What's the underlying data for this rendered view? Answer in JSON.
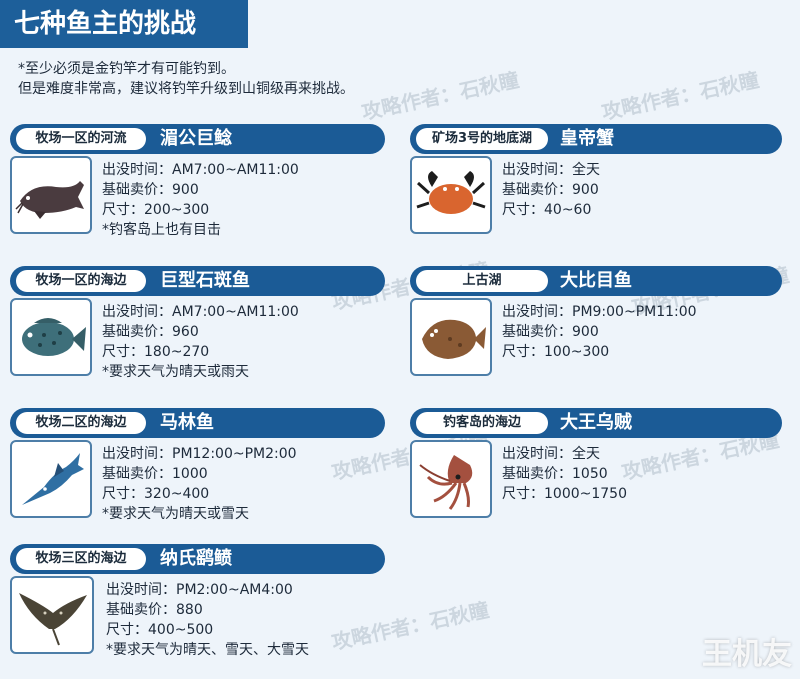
{
  "title": "七种鱼主的挑战",
  "notes": [
    "*至少必须是金钓竿才有可能钓到。",
    "但是难度非常高，建议将钓竿升级到山铜级再来挑战。"
  ],
  "watermark": "攻略作者：石秋瞳",
  "logo": "王机友",
  "fish": [
    {
      "location": "牧场一区的河流",
      "name": "湄公巨鲶",
      "time": "出没时间：AM7:00~AM11:00",
      "price": "基础卖价：900",
      "size": "尺寸：200~300",
      "note": "*钓客岛上也有目击",
      "icon": "catfish-icon",
      "color": "#4a3b3f"
    },
    {
      "location": "牧场一区的海边",
      "name": "巨型石斑鱼",
      "time": "出没时间：AM7:00~AM11:00",
      "price": "基础卖价：960",
      "size": "尺寸：180~270",
      "note": "*要求天气为晴天或雨天",
      "icon": "grouper-icon",
      "color": "#3e6f7a"
    },
    {
      "location": "牧场二区的海边",
      "name": "马林鱼",
      "time": "出没时间：PM12:00~PM2:00",
      "price": "基础卖价：1000",
      "size": "尺寸：320~400",
      "note": "*要求天气为晴天或雪天",
      "icon": "marlin-icon",
      "color": "#2f6fa3"
    },
    {
      "location": "牧场三区的海边",
      "name": "纳氏鹞鲼",
      "time": "出没时间：PM2:00~AM4:00",
      "price": "基础卖价：880",
      "size": "尺寸：400~500",
      "note": "*要求天气为晴天、雪天、大雪天",
      "icon": "eagle-ray-icon",
      "color": "#4a4436"
    },
    {
      "location": "矿场3号的地底湖",
      "name": "皇帝蟹",
      "time": "出没时间：全天",
      "price": "基础卖价：900",
      "size": "尺寸：40~60",
      "note": "",
      "icon": "crab-icon",
      "color": "#d9652f"
    },
    {
      "location": "上古湖",
      "name": "大比目鱼",
      "time": "出没时间：PM9:00~PM11:00",
      "price": "基础卖价：900",
      "size": "尺寸：100~300",
      "note": "",
      "icon": "halibut-icon",
      "color": "#8a5a35"
    },
    {
      "location": "钓客岛的海边",
      "name": "大王乌贼",
      "time": "出没时间：全天",
      "price": "基础卖价：1050",
      "size": "尺寸：1000~1750",
      "note": "",
      "icon": "squid-icon",
      "color": "#a4503f"
    }
  ]
}
